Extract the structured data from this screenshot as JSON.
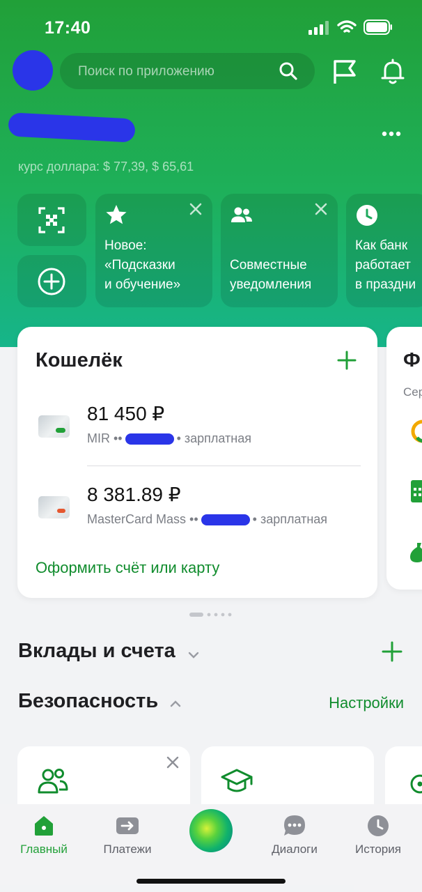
{
  "status_bar": {
    "time": "17:40"
  },
  "header": {
    "search_placeholder": "Поиск по приложению"
  },
  "greeting": {
    "rate_text": "курс доллара: $ 77,39, $ 65,61"
  },
  "stories": [
    {
      "text": "Новое:\n«Подсказки\nи обучение»",
      "icon": "star-icon"
    },
    {
      "text": "Совместные\nуведомления",
      "icon": "people-icon"
    },
    {
      "text": "Как банк\nработает\nв праздни",
      "icon": "clock-icon"
    }
  ],
  "wallet": {
    "title": "Кошелёк",
    "cards": [
      {
        "amount": "81 450 ₽",
        "system": "MIR ••",
        "suffix": "• зарплатная",
        "accent": "#21a038"
      },
      {
        "amount": "8 381.89 ₽",
        "system": "MasterCard Mass ••",
        "suffix": "• зарплатная",
        "accent": "#e5572f"
      }
    ],
    "open_link": "Оформить счёт или карту"
  },
  "side_card": {
    "title": "Ф",
    "subtitle": "Сер"
  },
  "sections": {
    "deposits": "Вклады и счета",
    "security": "Безопасность",
    "settings_link": "Настройки"
  },
  "tabs": [
    {
      "label": "Главный",
      "icon": "home-icon",
      "active": true
    },
    {
      "label": "Платежи",
      "icon": "payments-icon",
      "active": false
    },
    {
      "label": "Диалоги",
      "icon": "chat-icon",
      "active": false
    },
    {
      "label": "История",
      "icon": "history-icon",
      "active": false
    }
  ],
  "colors": {
    "brand": "#21a038",
    "link": "#108c2d",
    "mask": "#2a35e8"
  }
}
